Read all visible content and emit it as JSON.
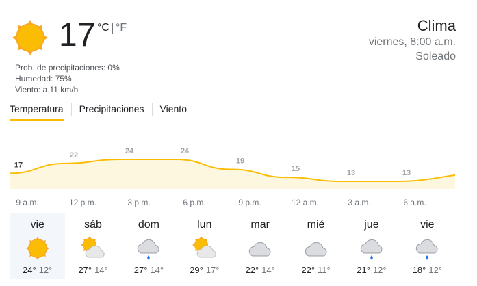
{
  "current": {
    "icon": "sun-icon",
    "temperature": "17",
    "unit_c": "°C",
    "unit_f": "°F",
    "precipitation": "Prob. de precipitaciones: 0%",
    "humidity": "Humedad: 75%",
    "wind": "Viento: a 11 km/h"
  },
  "header": {
    "title": "Clima",
    "datetime": "viernes, 8:00 a.m.",
    "condition": "Soleado"
  },
  "tabs": [
    {
      "label": "Temperatura",
      "active": true
    },
    {
      "label": "Precipitaciones",
      "active": false
    },
    {
      "label": "Viento",
      "active": false
    }
  ],
  "colors": {
    "accent": "#fbbc04",
    "chart_fill": "#fef7e0",
    "muted_text": "#70757a",
    "rain": "#1a73e8",
    "sun": "#f9a825"
  },
  "chart_data": {
    "type": "area",
    "values": [
      17,
      22,
      24,
      24,
      19,
      15,
      13,
      13
    ],
    "value_labels": [
      "17",
      "22",
      "24",
      "24",
      "19",
      "15",
      "13",
      "13"
    ],
    "time_labels": [
      "9 a.m.",
      "12 p.m.",
      "3 p.m.",
      "6 p.m.",
      "9 p.m.",
      "12 a.m.",
      "3 a.m.",
      "6 a.m."
    ]
  },
  "forecast": [
    {
      "day": "vie",
      "icon": "sun-icon",
      "high": "24°",
      "low": "12°",
      "selected": true
    },
    {
      "day": "sáb",
      "icon": "partly-cloudy-icon",
      "high": "27°",
      "low": "14°",
      "selected": false
    },
    {
      "day": "dom",
      "icon": "cloud-rain-icon",
      "high": "27°",
      "low": "14°",
      "selected": false
    },
    {
      "day": "lun",
      "icon": "partly-cloudy-icon",
      "high": "29°",
      "low": "17°",
      "selected": false
    },
    {
      "day": "mar",
      "icon": "cloud-icon",
      "high": "22°",
      "low": "14°",
      "selected": false
    },
    {
      "day": "mié",
      "icon": "cloud-icon",
      "high": "22°",
      "low": "11°",
      "selected": false
    },
    {
      "day": "jue",
      "icon": "cloud-rain-icon",
      "high": "21°",
      "low": "12°",
      "selected": false
    },
    {
      "day": "vie",
      "icon": "cloud-rain-icon",
      "high": "18°",
      "low": "12°",
      "selected": false
    }
  ]
}
